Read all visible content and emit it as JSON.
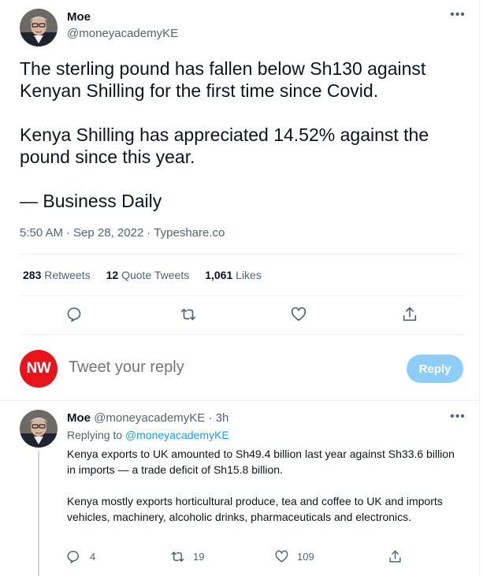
{
  "tweet": {
    "author": {
      "name": "Moe",
      "handle": "@moneyacademyKE"
    },
    "more_icon": "ellipsis-icon",
    "text": "The sterling pound has fallen below Sh130 against Kenyan Shilling for the first time since Covid.\n\nKenya Shilling has appreciated 14.52% against the pound since this year.\n\n— Business Daily",
    "time": "5:50 AM",
    "date": "Sep 28, 2022",
    "source": "Typeshare.co",
    "stats": {
      "retweets_count": "283",
      "retweets_label": "Retweets",
      "quotes_count": "12",
      "quotes_label": "Quote Tweets",
      "likes_count": "1,061",
      "likes_label": "Likes"
    },
    "actions": [
      "reply-icon",
      "retweet-icon",
      "like-icon",
      "share-icon"
    ]
  },
  "composer": {
    "avatar_text": "NW",
    "placeholder": "Tweet your reply",
    "button_label": "Reply",
    "avatar_color": "#e8141c",
    "button_color": "#8ecdf8"
  },
  "reply": {
    "author": {
      "name": "Moe",
      "handle": "@moneyacademyKE",
      "time": "3h"
    },
    "replying_label": "Replying to",
    "replying_to": "@moneyacademyKE",
    "text": "Kenya exports to UK amounted to Sh49.4 billion last year against Sh33.6 billion in imports — a trade deficit of Sh15.8 billion.\n\nKenya mostly exports horticultural produce, tea and coffee to UK and imports vehicles, machinery, alcoholic drinks, pharmaceuticals and electronics.",
    "counts": {
      "replies": "4",
      "retweets": "19",
      "likes": "109"
    }
  },
  "colors": {
    "text": "#0f1419",
    "muted": "#536471",
    "link": "#1d9bf0",
    "border": "#eff3f4"
  }
}
